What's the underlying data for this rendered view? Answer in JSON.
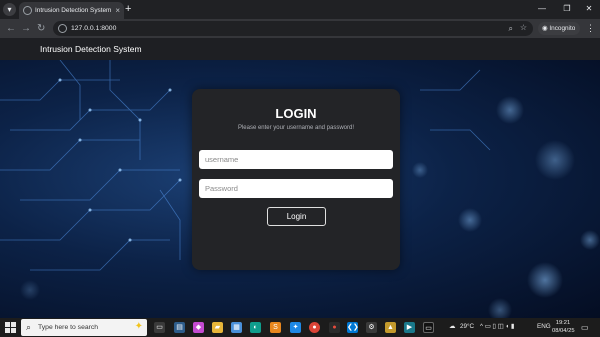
{
  "browser": {
    "tab_title": "Intrusion Detection System",
    "url": "127.0.0.1:8000",
    "profile_label": "Incognito",
    "new_tab_glyph": "+",
    "close_glyph": "×",
    "icons": [
      "tab-search-icon",
      "favicon",
      "close-icon",
      "new-tab-icon",
      "minimize-icon",
      "maximize-icon",
      "window-close-icon",
      "back-icon",
      "forward-icon",
      "reload-icon",
      "site-info-icon",
      "zoom-icon",
      "bookmark-star-icon",
      "incognito-icon",
      "menu-icon"
    ]
  },
  "app": {
    "brand": "Intrusion Detection System"
  },
  "login": {
    "heading": "LOGIN",
    "subtitle": "Please enter your username and password!",
    "username_placeholder": "username",
    "password_placeholder": "Password",
    "button_label": "Login"
  },
  "taskbar": {
    "search_placeholder": "Type here to search",
    "weather": "29°C",
    "language": "ENG",
    "time": "19:21",
    "date": "08/04/25"
  },
  "colors": {
    "page_bg": "#202124",
    "card_bg": "#232427",
    "background_blue": "#0c2247",
    "accent_white": "#ffffff"
  }
}
